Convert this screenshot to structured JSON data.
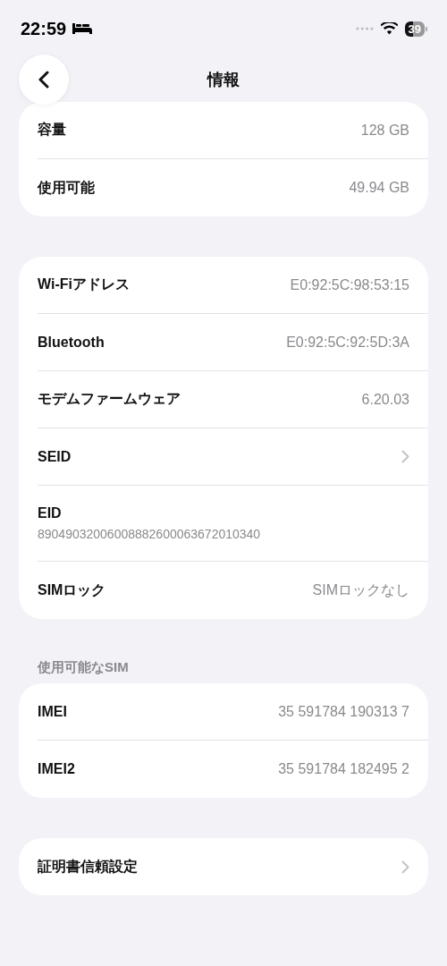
{
  "status_bar": {
    "time": "22:59",
    "battery": "39"
  },
  "nav": {
    "title": "情報"
  },
  "groups": [
    {
      "rows": [
        {
          "kind": "value",
          "label": "容量",
          "value": "128 GB"
        },
        {
          "kind": "value",
          "label": "使用可能",
          "value": "49.94 GB"
        }
      ]
    },
    {
      "rows": [
        {
          "kind": "value",
          "label": "Wi-Fiアドレス",
          "value": "E0:92:5C:98:53:15"
        },
        {
          "kind": "value",
          "label": "Bluetooth",
          "value": "E0:92:5C:92:5D:3A"
        },
        {
          "kind": "value",
          "label": "モデムファームウェア",
          "value": "6.20.03"
        },
        {
          "kind": "link",
          "label": "SEID"
        },
        {
          "kind": "stacked",
          "label": "EID",
          "value": "89049032006008882600063672010340"
        },
        {
          "kind": "value",
          "label": "SIMロック",
          "value": "SIMロックなし"
        }
      ]
    },
    {
      "header": "使用可能なSIM",
      "rows": [
        {
          "kind": "value",
          "label": "IMEI",
          "value": "35 591784 190313 7"
        },
        {
          "kind": "value",
          "label": "IMEI2",
          "value": "35 591784 182495 2"
        }
      ]
    },
    {
      "rows": [
        {
          "kind": "link",
          "label": "証明書信頼設定"
        }
      ]
    }
  ]
}
